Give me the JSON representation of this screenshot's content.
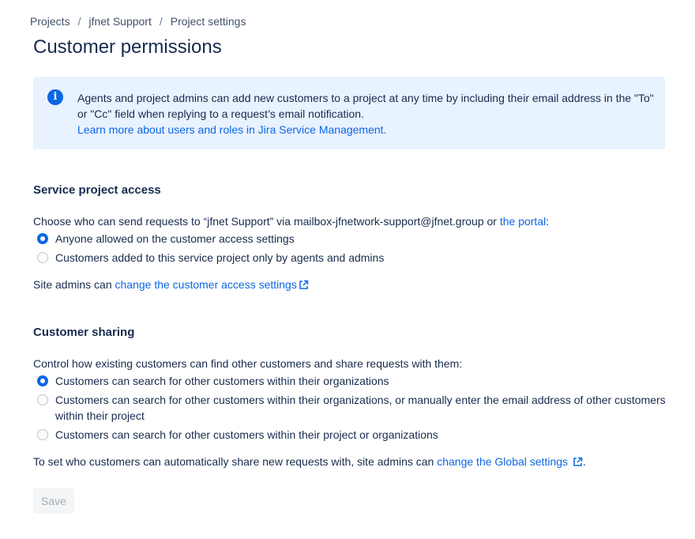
{
  "breadcrumb": {
    "items": [
      "Projects",
      "jfnet Support",
      "Project settings"
    ],
    "separator": "/"
  },
  "page_title": "Customer permissions",
  "info_banner": {
    "icon": "info-icon",
    "text_line1": "Agents and project admins can add new customers to a project at any time by including their email address in the \"To\"",
    "text_line2": "or \"Cc\" field when replying to a request’s email notification.",
    "link": "Learn more about users and roles in Jira Service Management."
  },
  "service_access": {
    "title": "Service project access",
    "prompt_before": "Choose who can send requests to “jfnet Support” via mailbox-jfnetwork-support@jfnet.group or ",
    "prompt_link": "the portal",
    "prompt_after": ":",
    "options": [
      {
        "label": "Anyone allowed on the customer access settings",
        "selected": true
      },
      {
        "label": "Customers added to this service project only by agents and admins",
        "selected": false
      }
    ],
    "note_before": "Site admins can ",
    "note_link": "change the customer access settings"
  },
  "customer_sharing": {
    "title": "Customer sharing",
    "prompt": "Control how existing customers can find other customers and share requests with them:",
    "options": [
      {
        "label": "Customers can search for other customers within their organizations",
        "selected": true
      },
      {
        "label": "Customers can search for other customers within their organizations, or manually enter the email address of other customers",
        "label_line2": "within their project",
        "selected": false
      },
      {
        "label": "Customers can search for other customers within their project or organizations",
        "selected": false
      }
    ],
    "note_before": "To set who customers can automatically share new requests with, site admins can ",
    "note_link": "change the Global settings",
    "note_after": "."
  },
  "save_button": "Save",
  "colors": {
    "link": "#0c66e4",
    "banner_bg": "#e9f2ff",
    "text": "#172b4d"
  }
}
